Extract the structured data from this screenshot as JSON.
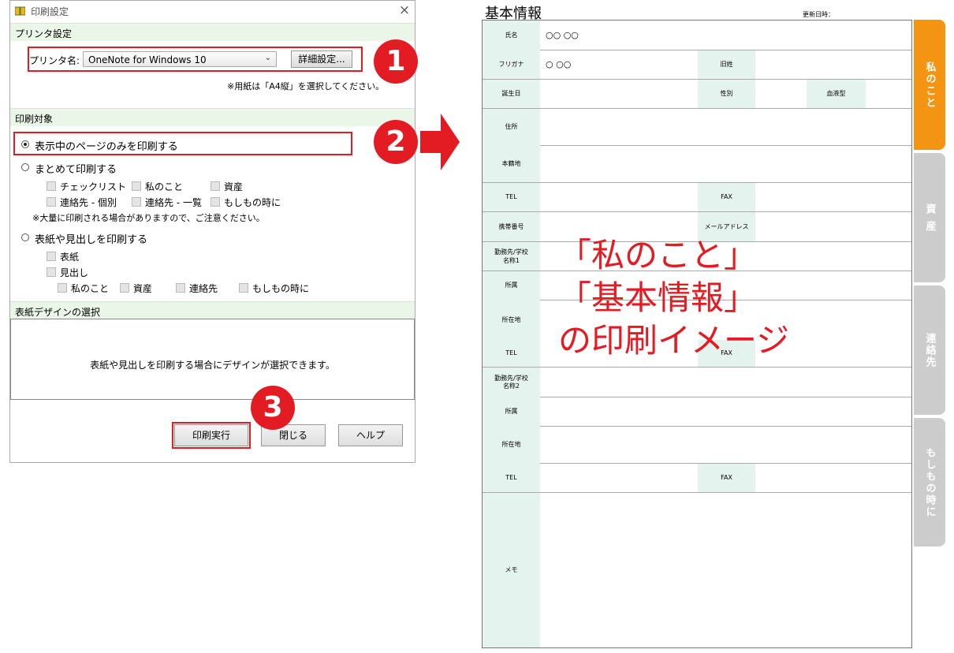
{
  "dialog": {
    "title": "印刷設定",
    "close_glyph": "×",
    "printer_section": "プリンタ設定",
    "printer_label": "プリンタ名:",
    "printer_value": "OneNote for Windows 10",
    "detail_button": "詳細設定...",
    "paper_note": "※用紙は「A4縦」を選択してください。",
    "target_section": "印刷対象",
    "option_current": "表示中のページのみを印刷する",
    "option_batch": "まとめて印刷する",
    "batch_items": [
      "チェックリスト",
      "私のこと",
      "資産",
      "連絡先 - 個別",
      "連絡先 - 一覧",
      "もしもの時に"
    ],
    "batch_note": "※大量に印刷される場合がありますので、ご注意ください。",
    "option_cover": "表紙や見出しを印刷する",
    "cover_label": "表紙",
    "heading_label": "見出し",
    "heading_items": [
      "私のこと",
      "資産",
      "連絡先",
      "もしもの時に"
    ],
    "design_section": "表紙デザインの選択",
    "design_text": "表紙や見出しを印刷する場合にデザインが選択できます。",
    "print_button": "印刷実行",
    "close_button": "閉じる",
    "help_button": "ヘルプ"
  },
  "badges": [
    "1",
    "2",
    "3"
  ],
  "sheet": {
    "title": "基本情報",
    "updated": "更新日時：",
    "labels": {
      "name": "氏名",
      "furigana": "フリガナ",
      "maiden": "旧姓",
      "birthday": "誕生日",
      "gender": "性別",
      "blood": "血液型",
      "address": "住所",
      "domicile": "本籍地",
      "tel": "TEL",
      "fax": "FAX",
      "mobile": "携帯番号",
      "email": "メールアドレス",
      "work1": "勤務先/学校\n名称1",
      "dept": "所属",
      "location": "所在地",
      "work2": "勤務先/学校\n名称2",
      "memo": "メモ"
    },
    "values": {
      "name": "○○ ○○",
      "furigana": "○ ○○"
    }
  },
  "overlay_lines": [
    "「私のこと」",
    "「基本情報」",
    "の印刷イメージ"
  ],
  "tabs": [
    {
      "label": "私のこと",
      "color": "#f39512"
    },
    {
      "label": "資 産",
      "color": "#cccccc"
    },
    {
      "label": "連絡先",
      "color": "#cccccc"
    },
    {
      "label": "もしもの時に",
      "color": "#cccccc"
    }
  ],
  "colors": {
    "accent_red": "#e31b23",
    "label_bg": "#e5f3ef",
    "section_bg": "#eaf6e7"
  }
}
